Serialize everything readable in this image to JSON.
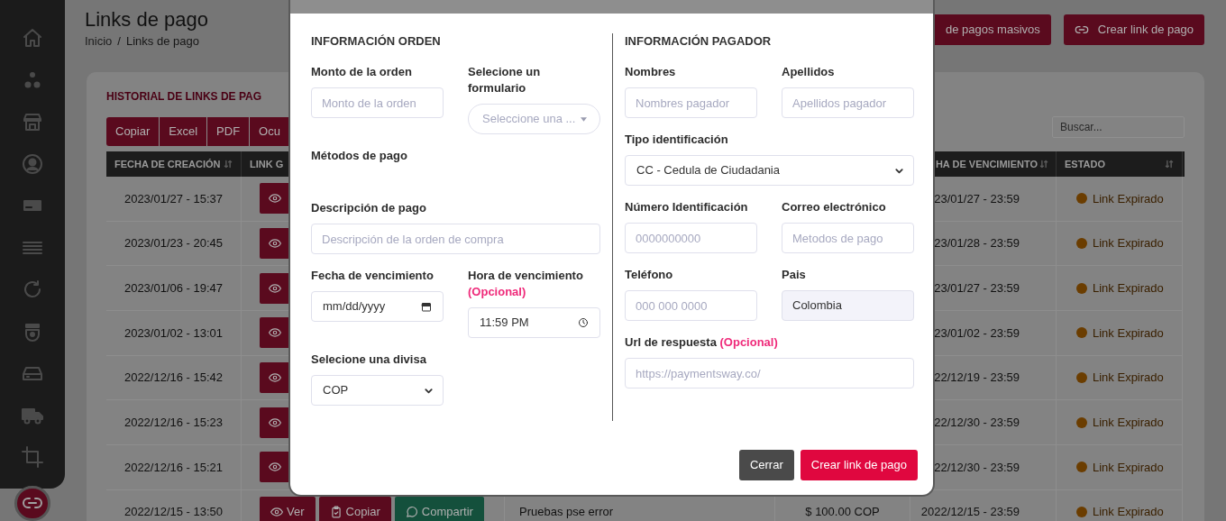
{
  "sidebar": {
    "items": [
      {
        "selected": false
      },
      {
        "selected": false
      },
      {
        "selected": false
      },
      {
        "selected": false
      },
      {
        "selected": false
      },
      {
        "selected": false
      },
      {
        "selected": false
      },
      {
        "selected": false
      },
      {
        "selected": false
      },
      {
        "selected": false
      },
      {
        "selected": false
      },
      {
        "selected": true
      }
    ]
  },
  "page": {
    "title": "Links de pago",
    "breadcrumb": {
      "items": [
        "Inicio",
        "Links de pago"
      ],
      "separator": "/"
    },
    "actions": [
      {
        "kind": "plain",
        "label": "de pagos masivos"
      },
      {
        "kind": "link",
        "label": "Crear link de pago"
      }
    ]
  },
  "card": {
    "title": "HISTORIAL DE LINKS DE PAG",
    "export_buttons": [
      "Copiar",
      "Excel",
      "PDF",
      "Ocu"
    ],
    "search": {
      "placeholder": "Buscar..."
    },
    "table": {
      "columns": [
        {
          "label": "FECHA DE CREACIÓN"
        },
        {
          "label": "LINK G"
        },
        {
          "label": "HA DE VENCIMIENTO"
        },
        {
          "label": "ESTADO"
        }
      ],
      "rows": [
        {
          "created": "2023/01/27 - 15:37",
          "actions": [
            {
              "kind": "view"
            }
          ],
          "expires": "23/01/27 - 23:59",
          "status": "Link Expirado"
        },
        {
          "created": "2023/01/23 - 20:45",
          "actions": [
            {
              "kind": "view"
            }
          ],
          "expires": "23/01/28 - 23:59",
          "status": "Link Expirado"
        },
        {
          "created": "2023/01/06 - 19:47",
          "actions": [
            {
              "kind": "view"
            }
          ],
          "expires": "23/01/27 - 23:59",
          "status": "Link Expirado"
        },
        {
          "created": "2023/01/02 - 13:01",
          "actions": [
            {
              "kind": "view"
            }
          ],
          "expires": "23/01/02 - 23:59",
          "status": "Link Expirado"
        },
        {
          "created": "2022/12/16 - 15:42",
          "actions": [
            {
              "kind": "view"
            }
          ],
          "expires": "22/12/19 - 23:59",
          "status": "Link Expirado"
        },
        {
          "created": "2022/12/16 - 15:23",
          "actions": [
            {
              "kind": "view"
            }
          ],
          "expires": "22/12/30 - 23:59",
          "status": "Link Expirado"
        },
        {
          "created": "2022/12/16 - 15:21",
          "actions": [
            {
              "kind": "view"
            }
          ],
          "expires": "22/12/30 - 23:59",
          "status": "Link Expirado"
        },
        {
          "created": "2022/12/15 - 13:50",
          "actions": [
            {
              "kind": "view",
              "label": "Ver"
            },
            {
              "kind": "copy",
              "label": "Copiar"
            },
            {
              "kind": "share",
              "label": "Compartir"
            }
          ],
          "description": "Pruebas pse error",
          "amount": "$ 100.00 COP",
          "expires": "2022/12/15 - 23:59",
          "status": "Link Expirado"
        }
      ]
    }
  },
  "modal": {
    "sections": [
      {
        "heading": "INFORMACIÓN ORDEN",
        "fields": [
          {
            "kind": "input",
            "label": "Monto de la orden",
            "placeholder": "Monto de la orden"
          },
          {
            "kind": "pill-select",
            "label": "Selecione un formulario",
            "placeholder": "Seleccione una ..."
          },
          {
            "kind": "none",
            "label": "Métodos de pago",
            "wide": true
          },
          {
            "kind": "input",
            "label": "Descripción de pago",
            "placeholder": "Descripción de la orden de compra",
            "wide": true
          },
          {
            "kind": "date",
            "label": "Fecha de vencimiento",
            "placeholder": "mm/dd/yyyy"
          },
          {
            "kind": "time",
            "label": "Hora de vencimiento",
            "note": "(Opcional)",
            "value": "11:59 PM"
          },
          {
            "kind": "select",
            "label": "Selecione una divisa",
            "value": "COP"
          }
        ]
      },
      {
        "heading": "INFORMACIÓN PAGADOR",
        "fields": [
          {
            "kind": "input",
            "label": "Nombres",
            "placeholder": "Nombres pagador"
          },
          {
            "kind": "input",
            "label": "Apellidos",
            "placeholder": "Apellidos pagador"
          },
          {
            "kind": "select",
            "label": "Tipo identificación",
            "value": "CC - Cedula de Ciudadania",
            "wide": true
          },
          {
            "kind": "input",
            "label": "Número Identificación",
            "placeholder": "0000000000"
          },
          {
            "kind": "input",
            "label": "Correo electrónico",
            "placeholder": "Metodos de pago"
          },
          {
            "kind": "input",
            "label": "Teléfono",
            "placeholder": "000 000 0000"
          },
          {
            "kind": "readonly",
            "label": "Pais",
            "value": "Colombia"
          },
          {
            "kind": "input",
            "label": "Url de respuesta",
            "note": "(Opcional)",
            "placeholder": "https://paymentsway.co/",
            "wide": true
          }
        ]
      }
    ],
    "buttons": [
      {
        "kind": "secondary",
        "label": "Cerrar"
      },
      {
        "kind": "primary",
        "label": "Crear link de pago"
      }
    ]
  }
}
